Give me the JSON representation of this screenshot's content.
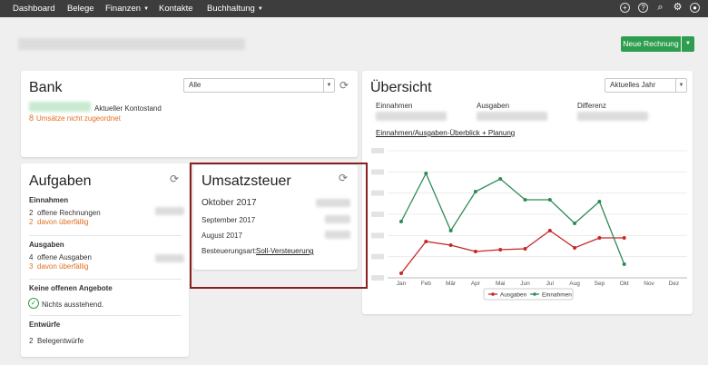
{
  "nav": {
    "items": [
      {
        "label": "Dashboard"
      },
      {
        "label": "Belege"
      },
      {
        "label": "Finanzen"
      },
      {
        "label": "Kontakte"
      },
      {
        "label": "Buchhaltung"
      }
    ]
  },
  "header": {
    "new_invoice_label": "Neue Rechnung"
  },
  "bank": {
    "title": "Bank",
    "filter": "Alle",
    "balance_label": "Aktueller Kontostand",
    "unassigned_count": "8",
    "unassigned_label": "Umsätze nicht zugeordnet"
  },
  "uebersicht": {
    "title": "Übersicht",
    "period": "Aktuelles Jahr",
    "col_income": "Einnahmen",
    "col_expenses": "Ausgaben",
    "col_difference": "Differenz",
    "link": "Einnahmen/Ausgaben-Überblick + Planung"
  },
  "aufgaben": {
    "title": "Aufgaben",
    "income_heading": "Einnahmen",
    "income_open_count": "2",
    "income_open_label": "offene Rechnungen",
    "income_overdue_count": "2",
    "income_overdue_label": "davon überfällig",
    "expenses_heading": "Ausgaben",
    "expenses_open_count": "4",
    "expenses_open_label": "offene Ausgaben",
    "expenses_overdue_count": "3",
    "expenses_overdue_label": "davon überfällig",
    "offers_heading": "Keine offenen Angebote",
    "offers_status": "Nichts ausstehend.",
    "drafts_heading": "Entwürfe",
    "drafts_count": "2",
    "drafts_label": "Belegentwürfe"
  },
  "ust": {
    "title": "Umsatzsteuer",
    "month1": "Oktober 2017",
    "month2": "September 2017",
    "month3": "August 2017",
    "method_label": "Besteuerungsart:",
    "method_value": "Soll-Versteuerung"
  },
  "chart_data": {
    "type": "line",
    "categories": [
      "Jan",
      "Feb",
      "Mär",
      "Apr",
      "Mai",
      "Jun",
      "Jul",
      "Aug",
      "Sep",
      "Okt",
      "Nov",
      "Dez"
    ],
    "series": [
      {
        "name": "Ausgaben",
        "color": "#c62828",
        "values": [
          0.5,
          4.0,
          3.6,
          2.9,
          3.1,
          3.2,
          5.2,
          3.3,
          4.4,
          4.4,
          null,
          null
        ]
      },
      {
        "name": "Einnahmen",
        "color": "#2e8b57",
        "values": [
          6.2,
          11.5,
          5.2,
          9.5,
          10.9,
          8.6,
          8.6,
          6.0,
          8.4,
          1.5,
          null,
          null
        ]
      }
    ],
    "ylim": [
      0,
      14
    ],
    "grid": true,
    "legend": "bottom"
  }
}
